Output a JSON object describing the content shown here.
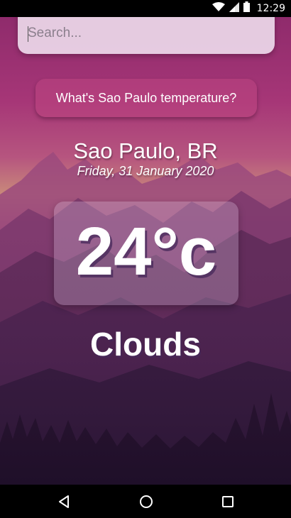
{
  "status_bar": {
    "time": "12:29",
    "icons": [
      "wifi-icon",
      "signal-icon",
      "battery-icon"
    ]
  },
  "search": {
    "placeholder": "Search...",
    "value": ""
  },
  "question_button": {
    "label": "What's Sao Paulo temperature?"
  },
  "weather": {
    "location": "Sao Paulo, BR",
    "date": "Friday, 31 January 2020",
    "temperature": "24°c",
    "condition": "Clouds"
  },
  "nav_bar": {
    "buttons": [
      "back-icon",
      "home-icon",
      "recents-icon"
    ]
  },
  "colors": {
    "sky_top": "#9c2f73",
    "sky_mid": "#b84a82",
    "horizon": "#c98a7a",
    "mountain_dark": "#2b1535",
    "card_bg": "#dcc8e1"
  }
}
